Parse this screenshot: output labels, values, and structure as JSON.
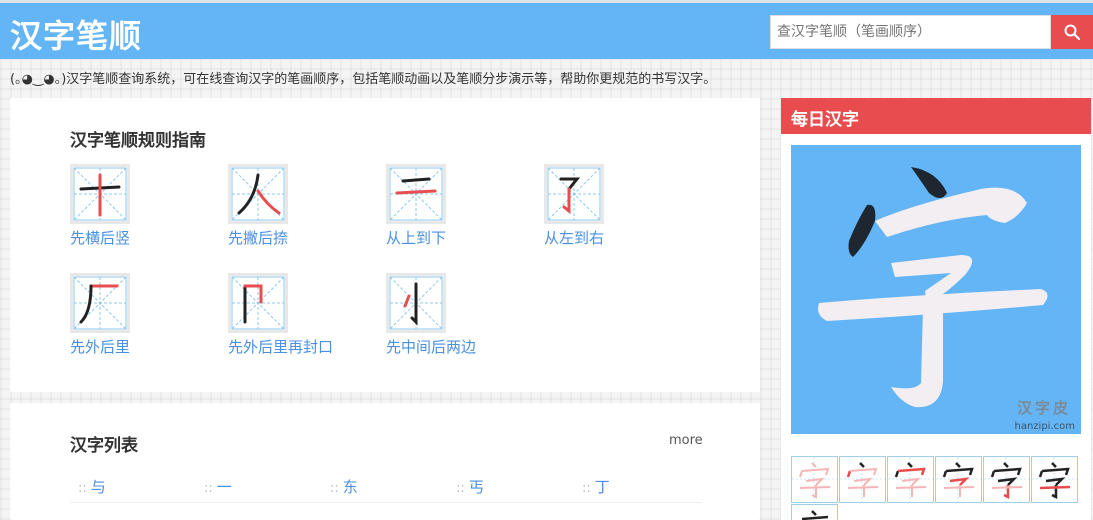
{
  "header": {
    "logo": "汉字笔顺",
    "search_placeholder": "查汉字笔顺（笔画顺序）",
    "search_icon": "search-icon",
    "accent": "#64b5f6",
    "button_color": "#e84c4f"
  },
  "description": "(｡◕‿◕｡)汉字笔顺查询系统，可在线查询汉字的笔画顺序，包括笔顺动画以及笔顺分步演示等，帮助你更规范的书写汉字。",
  "rules_section": {
    "title": "汉字笔顺规则指南",
    "rules": [
      {
        "label": "先横后竖",
        "char": "十"
      },
      {
        "label": "先撇后捺",
        "char": "人"
      },
      {
        "label": "从上到下",
        "char": "二"
      },
      {
        "label": "从左到右",
        "char": "孑"
      },
      {
        "label": "先外后里",
        "char": "厂"
      },
      {
        "label": "先外后里再封口",
        "char": "冂"
      },
      {
        "label": "先中间后两边",
        "char": "小"
      }
    ]
  },
  "list_section": {
    "title": "汉字列表",
    "more": "more",
    "chars": [
      "与",
      "一",
      "东",
      "丐",
      "丁"
    ]
  },
  "sidebar": {
    "title": "每日汉字",
    "char": "字",
    "watermark": "汉字皮",
    "watermark_url": "hanzipi.com",
    "steps": [
      "宀",
      "宀",
      "宀",
      "字",
      "字",
      "字",
      "字"
    ]
  }
}
